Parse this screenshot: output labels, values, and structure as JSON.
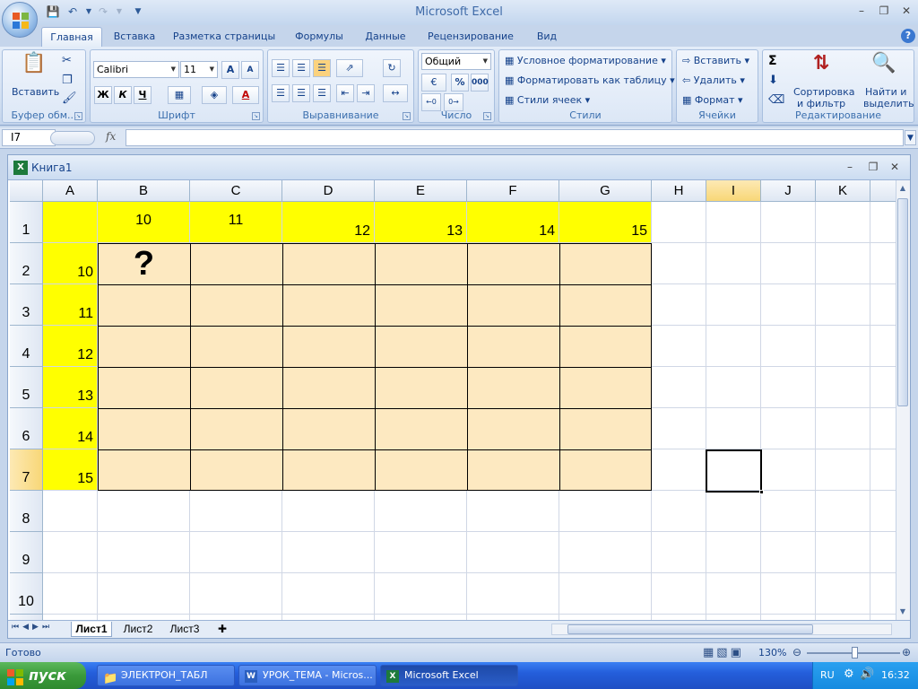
{
  "app": {
    "title": "Microsoft Excel"
  },
  "ribbon": {
    "tabs": [
      "Главная",
      "Вставка",
      "Разметка страницы",
      "Формулы",
      "Данные",
      "Рецензирование",
      "Вид"
    ],
    "clipboard": {
      "paste": "Вставить",
      "label": "Буфер обм..."
    },
    "font": {
      "name": "Calibri",
      "size": "11",
      "bold": "Ж",
      "italic": "К",
      "underline": "Ч",
      "grow": "A",
      "shrink": "A",
      "color_a": "A",
      "label": "Шрифт"
    },
    "alignment": {
      "label": "Выравнивание"
    },
    "number": {
      "format": "Общий",
      "percent": "%",
      "thousands": "000",
      "label": "Число"
    },
    "styles": {
      "conditional": "Условное форматирование",
      "as_table": "Форматировать как таблицу",
      "cell_styles": "Стили ячеек",
      "label": "Стили"
    },
    "cells": {
      "insert": "Вставить",
      "delete": "Удалить",
      "format": "Формат",
      "label": "Ячейки"
    },
    "editing": {
      "sigma": "Σ",
      "sort1": "Сортировка",
      "sort2": "и фильтр",
      "find1": "Найти и",
      "find2": "выделить",
      "label": "Редактирование"
    }
  },
  "formula_bar": {
    "name_box": "I7",
    "fx": "fx",
    "value": ""
  },
  "workbook": {
    "title": "Книга1"
  },
  "columns": [
    "A",
    "B",
    "C",
    "D",
    "E",
    "F",
    "G",
    "H",
    "I",
    "J",
    "K"
  ],
  "rows": [
    "1",
    "2",
    "3",
    "4",
    "5",
    "6",
    "7",
    "8",
    "9",
    "10"
  ],
  "cells": {
    "B1": "10",
    "C1": "11",
    "D1": "12",
    "E1": "13",
    "F1": "14",
    "G1": "15",
    "A2": "10",
    "A3": "11",
    "A4": "12",
    "A5": "13",
    "A6": "14",
    "A7": "15",
    "B2": "?"
  },
  "sheets": [
    "Лист1",
    "Лист2",
    "Лист3"
  ],
  "status": {
    "ready": "Готово",
    "zoom": "130%"
  },
  "taskbar": {
    "start": "пуск",
    "tasks": [
      "ЭЛЕКТРОН_ТАБЛ",
      "УРОК_ТЕМА - Micros...",
      "Microsoft Excel"
    ],
    "lang": "RU",
    "clock": "16:32"
  },
  "colors": {
    "yellow": "#ffff00",
    "peach": "#fde9c1",
    "ribbon": "#dce7f6",
    "taskbar": "#245edb"
  }
}
